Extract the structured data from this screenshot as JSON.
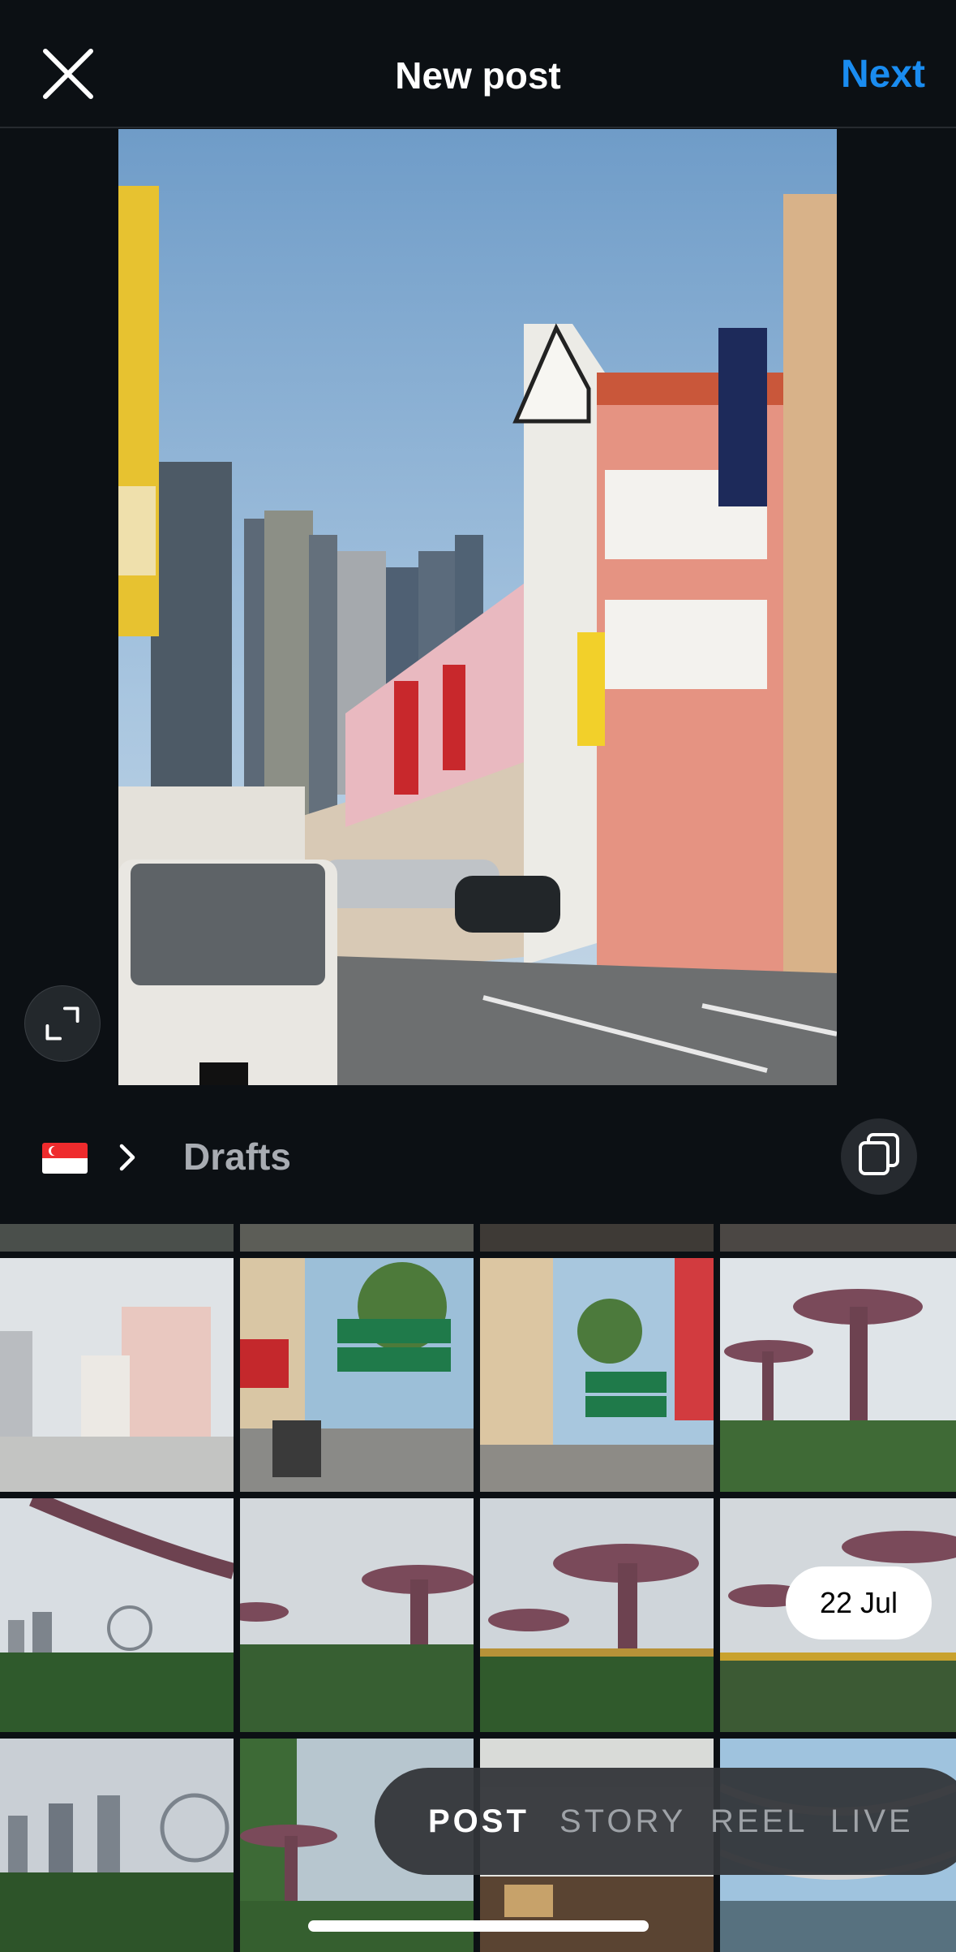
{
  "header": {
    "title": "New post",
    "next_label": "Next",
    "close_icon": "close-icon"
  },
  "preview": {
    "expand_icon": "expand-icon",
    "photo": "street-shophouses-photo"
  },
  "album": {
    "flag_icon": "singapore-flag-icon",
    "chevron_icon": "chevron-right-icon",
    "label": "Drafts",
    "multi_select_icon": "multi-select-icon"
  },
  "grid": {
    "date_badge": "22 Jul",
    "tiles": [
      "street-photo-faded",
      "mosque-street-sign-photo",
      "mosque-street-sign-photo-2",
      "supertree-photo",
      "supertree-skyline-photo",
      "supertree-cloudy-photo",
      "skywalk-photo",
      "skywalk-photo-2",
      "skyline-ferris-wheel-photo",
      "supertree-palms-photo",
      "market-photo",
      "bridge-photo"
    ]
  },
  "modes": {
    "items": [
      "POST",
      "STORY",
      "REEL",
      "LIVE"
    ],
    "selected": "POST"
  },
  "colors": {
    "background": "#0c1014",
    "accent": "#1a8cf0",
    "secondary_text": "#a8acb2"
  }
}
